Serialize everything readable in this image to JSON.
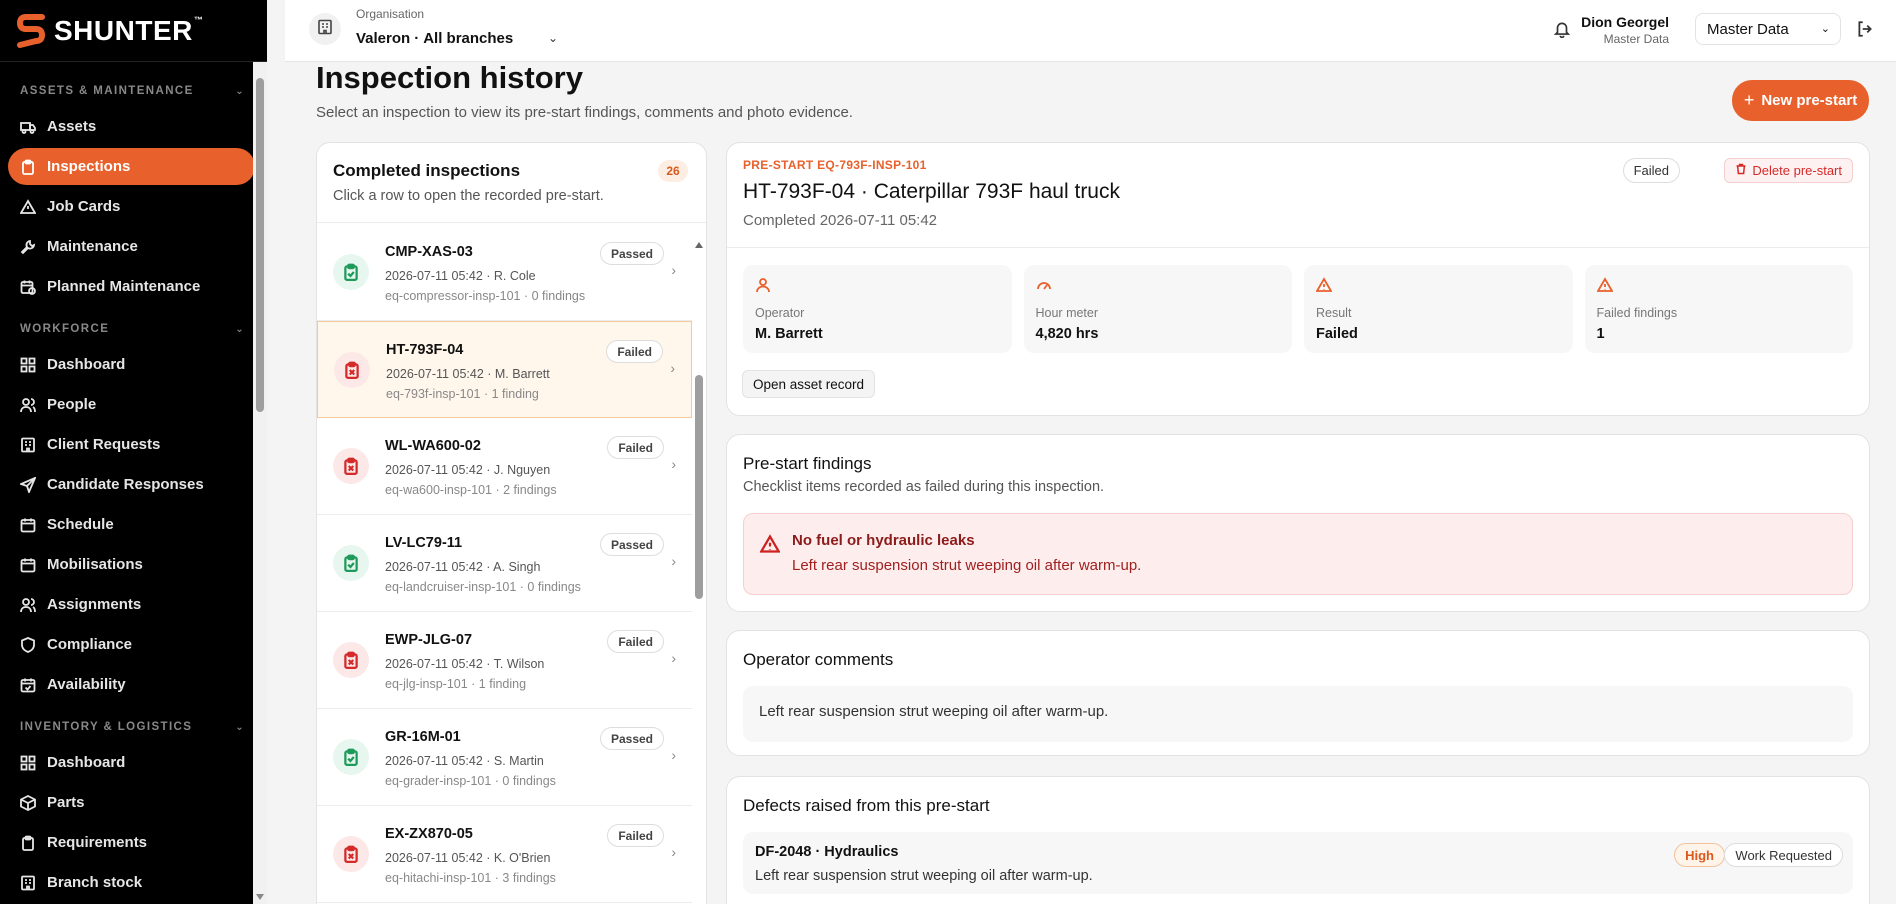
{
  "brand": {
    "name": "SHUNTER",
    "tm": "™",
    "accent": "#e8612c"
  },
  "sidebar": {
    "sections": [
      {
        "title": "ASSETS & MAINTENANCE",
        "items": [
          {
            "label": "Assets",
            "icon": "truck-icon"
          },
          {
            "label": "Inspections",
            "icon": "clipboard-icon",
            "active": true
          },
          {
            "label": "Job Cards",
            "icon": "warning-icon"
          },
          {
            "label": "Maintenance",
            "icon": "wrench-icon"
          },
          {
            "label": "Planned Maintenance",
            "icon": "calendar-clock-icon"
          }
        ]
      },
      {
        "title": "WORKFORCE",
        "items": [
          {
            "label": "Dashboard",
            "icon": "grid-icon"
          },
          {
            "label": "People",
            "icon": "people-icon"
          },
          {
            "label": "Client Requests",
            "icon": "building-icon"
          },
          {
            "label": "Candidate Responses",
            "icon": "send-icon"
          },
          {
            "label": "Schedule",
            "icon": "calendar-icon"
          },
          {
            "label": "Mobilisations",
            "icon": "calendar-icon"
          },
          {
            "label": "Assignments",
            "icon": "people-icon"
          },
          {
            "label": "Compliance",
            "icon": "shield-icon"
          },
          {
            "label": "Availability",
            "icon": "calendar-check-icon"
          }
        ]
      },
      {
        "title": "INVENTORY & LOGISTICS",
        "items": [
          {
            "label": "Dashboard",
            "icon": "grid-icon"
          },
          {
            "label": "Parts",
            "icon": "box-icon"
          },
          {
            "label": "Requirements",
            "icon": "clipboard-icon"
          },
          {
            "label": "Branch stock",
            "icon": "building-icon"
          }
        ]
      }
    ]
  },
  "topbar": {
    "org_label": "Organisation",
    "org_name": "Valeron",
    "org_sep": "·",
    "org_branch": "All branches",
    "user_name": "Dion Georgel",
    "user_role": "Master Data",
    "role_select": "Master Data"
  },
  "page": {
    "title": "Inspection history",
    "subtitle": "Select an inspection to view its pre-start findings, comments and photo evidence.",
    "new_button": "New pre-start"
  },
  "list": {
    "title": "Completed inspections",
    "subtitle": "Click a row to open the recorded pre-start.",
    "count": "26",
    "rows": [
      {
        "code": "CMP-XAS-03",
        "meta": "2026-07-11 05:42 · R. Cole",
        "sub": "eq-compressor-insp-101 · 0 findings",
        "status": "Passed"
      },
      {
        "code": "HT-793F-04",
        "meta": "2026-07-11 05:42 · M. Barrett",
        "sub": "eq-793f-insp-101 · 1 finding",
        "status": "Failed",
        "selected": true
      },
      {
        "code": "WL-WA600-02",
        "meta": "2026-07-11 05:42 · J. Nguyen",
        "sub": "eq-wa600-insp-101 · 2 findings",
        "status": "Failed"
      },
      {
        "code": "LV-LC79-11",
        "meta": "2026-07-11 05:42 · A. Singh",
        "sub": "eq-landcruiser-insp-101 · 0 findings",
        "status": "Passed"
      },
      {
        "code": "EWP-JLG-07",
        "meta": "2026-07-11 05:42 · T. Wilson",
        "sub": "eq-jlg-insp-101 · 1 finding",
        "status": "Failed"
      },
      {
        "code": "GR-16M-01",
        "meta": "2026-07-11 05:42 · S. Martin",
        "sub": "eq-grader-insp-101 · 0 findings",
        "status": "Passed"
      },
      {
        "code": "EX-ZX870-05",
        "meta": "2026-07-11 05:42 · K. O'Brien",
        "sub": "eq-hitachi-insp-101 · 3 findings",
        "status": "Failed"
      }
    ]
  },
  "detail": {
    "eyebrow": "PRE-START EQ-793F-INSP-101",
    "title": "HT-793F-04 · Caterpillar 793F haul truck",
    "completed": "Completed 2026-07-11 05:42",
    "status": "Failed",
    "delete_label": "Delete pre-start",
    "stats": [
      {
        "label": "Operator",
        "value": "M. Barrett",
        "icon": "user-icon"
      },
      {
        "label": "Hour meter",
        "value": "4,820 hrs",
        "icon": "gauge-icon"
      },
      {
        "label": "Result",
        "value": "Failed",
        "icon": "warning-icon"
      },
      {
        "label": "Failed findings",
        "value": "1",
        "icon": "warning-icon"
      }
    ],
    "asset_button": "Open asset record"
  },
  "findings": {
    "title": "Pre-start findings",
    "subtitle": "Checklist items recorded as failed during this inspection.",
    "alert_title": "No fuel or hydraulic leaks",
    "alert_body": "Left rear suspension strut weeping oil after warm-up."
  },
  "comments": {
    "title": "Operator comments",
    "body": "Left rear suspension strut weeping oil after warm-up."
  },
  "defects": {
    "title": "Defects raised from this pre-start",
    "items": [
      {
        "title": "DF-2048 · Hydraulics",
        "body": "Left rear suspension strut weeping oil after warm-up.",
        "priority": "High",
        "status": "Work Requested"
      }
    ]
  }
}
